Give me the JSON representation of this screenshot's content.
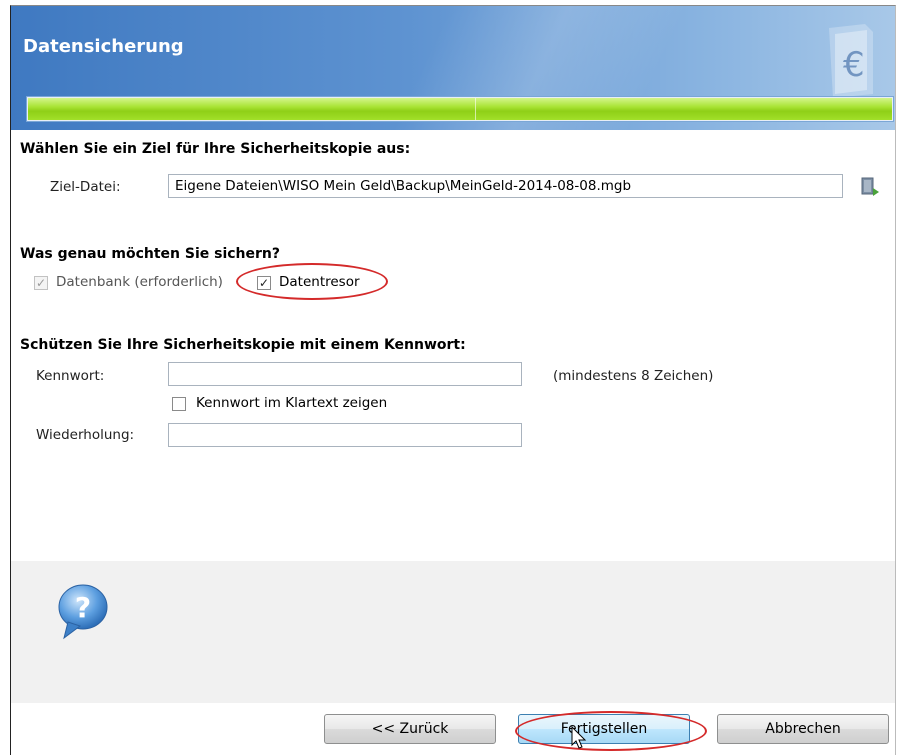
{
  "window": {
    "title": "Datensicherung",
    "progress": 1.0
  },
  "target": {
    "heading": "Wählen Sie ein Ziel für Ihre Sicherheitskopie aus:",
    "file_label": "Ziel-Datei:",
    "file_value": "Eigene Dateien\\WISO Mein Geld\\Backup\\MeinGeld-2014-08-08.mgb",
    "browse_icon": "folder-browse-icon"
  },
  "scope": {
    "heading": "Was genau möchten Sie sichern?",
    "options": [
      {
        "label": "Datenbank (erforderlich)",
        "checked": true,
        "enabled": false
      },
      {
        "label": "Datentresor",
        "checked": true,
        "enabled": true
      }
    ]
  },
  "password": {
    "heading": "Schützen Sie Ihre Sicherheitskopie mit einem Kennwort:",
    "password_label": "Kennwort:",
    "password_value": "",
    "hint": "(mindestens 8 Zeichen)",
    "show_plain_label": "Kennwort im Klartext zeigen",
    "show_plain_checked": false,
    "repeat_label": "Wiederholung:",
    "repeat_value": ""
  },
  "help": {
    "icon": "help-question-icon"
  },
  "buttons": {
    "back": "<< Zurück",
    "finish": "Fertigstellen",
    "cancel": "Abbrechen"
  },
  "colors": {
    "header": "#3f79c1",
    "progress": "#9ad81f",
    "highlight": "#d42a2a"
  }
}
